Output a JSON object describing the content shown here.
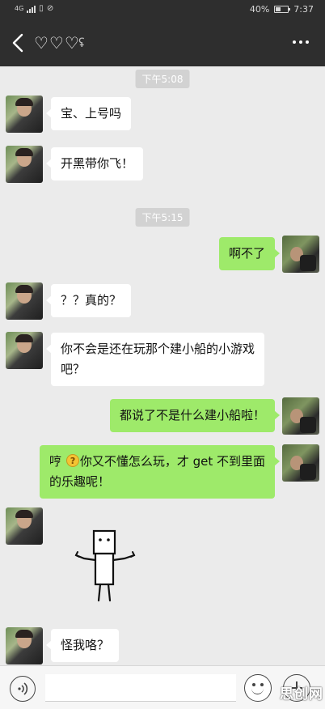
{
  "status_bar": {
    "network": "4G",
    "battery": "40%",
    "time": "7:37"
  },
  "nav": {
    "title": "♡♡♡",
    "back_icon": "chevron-left-icon",
    "earpiece_icon": "ear-icon",
    "more_icon": "more-dots-icon"
  },
  "timestamps": [
    "下午5:08",
    "下午5:15"
  ],
  "messages": [
    {
      "side": "left",
      "text": "宝、上号吗"
    },
    {
      "side": "left",
      "text": "开黑带你飞！"
    },
    {
      "side": "right",
      "text": "啊不了"
    },
    {
      "side": "left",
      "text": "？？真的？"
    },
    {
      "side": "left",
      "line1": "你不会是还在玩那个建小船的小游戏",
      "line2": "吧？"
    },
    {
      "side": "right",
      "text": "都说了不是什么建小船啦！"
    },
    {
      "side": "right",
      "before_emoji": "哼 ",
      "emoji": "confused-face-emoji",
      "after_emoji": "你又不懂怎么玩，才 get 不到里面",
      "line2": "的乐趣呢！"
    },
    {
      "side": "left",
      "type": "sticker",
      "sticker": "shrugging-box-figure"
    },
    {
      "side": "left",
      "text": "怪我咯？"
    }
  ],
  "input_bar": {
    "voice_icon": "voice-icon",
    "emoji_icon": "emoji-smile-icon",
    "add_icon": "plus-icon"
  },
  "watermark": "思创网",
  "colors": {
    "header": "#2e2e2e",
    "background": "#ebebeb",
    "sent_bubble": "#9eea6a",
    "received_bubble": "#ffffff"
  }
}
